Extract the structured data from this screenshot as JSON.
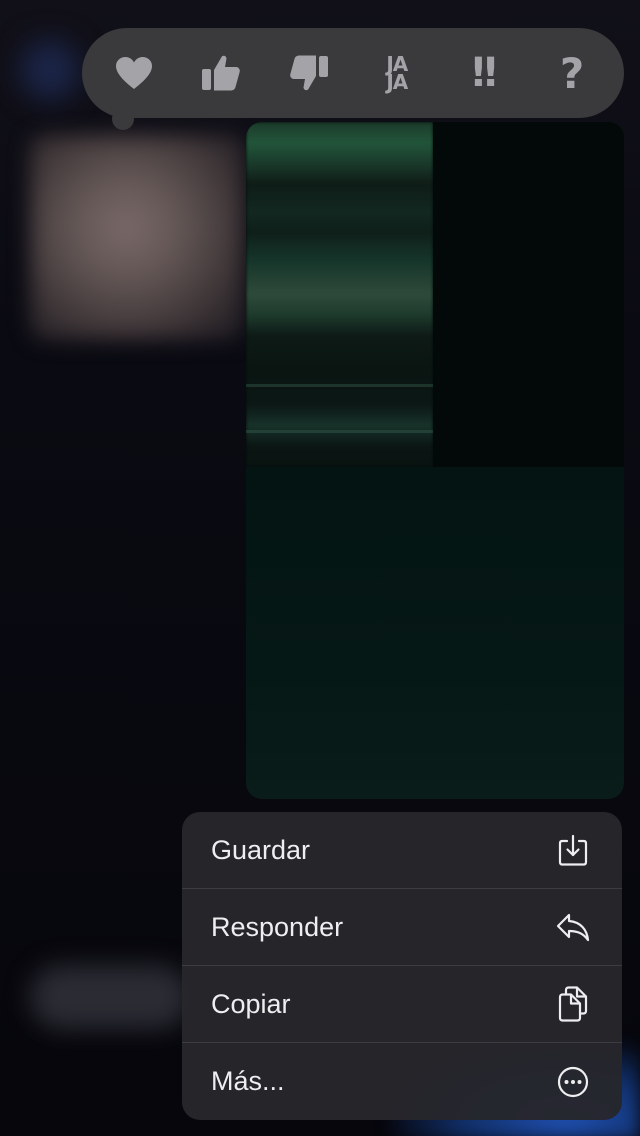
{
  "reactions": [
    {
      "name": "heart",
      "icon": "heart-icon"
    },
    {
      "name": "thumbs-up",
      "icon": "thumbs-up-icon"
    },
    {
      "name": "thumbs-down",
      "icon": "thumbs-down-icon"
    },
    {
      "name": "haha",
      "icon": "haha-icon",
      "label_line1": "JA",
      "label_line2": "JA"
    },
    {
      "name": "emphasize",
      "icon": "double-exclamation-icon",
      "label": "!!"
    },
    {
      "name": "question",
      "icon": "question-mark-icon",
      "label": "?"
    }
  ],
  "menu": {
    "items": [
      {
        "label": "Guardar",
        "icon": "save-download-icon"
      },
      {
        "label": "Responder",
        "icon": "reply-arrow-icon"
      },
      {
        "label": "Copiar",
        "icon": "copy-documents-icon"
      },
      {
        "label": "Más...",
        "icon": "more-ellipsis-icon"
      }
    ]
  },
  "colors": {
    "reaction_bar": "#3a3a3d",
    "reaction_icon": "#a4a4a8",
    "menu_background": "#26262c",
    "menu_text": "#eeeef0",
    "menu_divider": "#3c3c43"
  }
}
